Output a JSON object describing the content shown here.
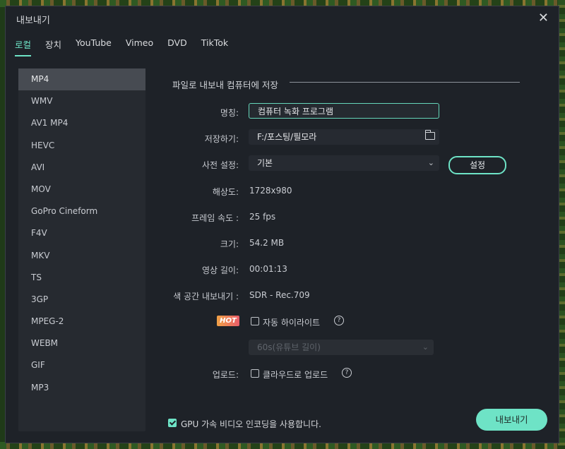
{
  "dialog": {
    "title": "내보내기",
    "close_glyph": "✕"
  },
  "tabs": [
    {
      "label": "로컬",
      "active": true
    },
    {
      "label": "장치"
    },
    {
      "label": "YouTube"
    },
    {
      "label": "Vimeo"
    },
    {
      "label": "DVD"
    },
    {
      "label": "TikTok"
    }
  ],
  "formats": [
    "MP4",
    "WMV",
    "AV1 MP4",
    "HEVC",
    "AVI",
    "MOV",
    "GoPro Cineform",
    "F4V",
    "MKV",
    "TS",
    "3GP",
    "MPEG-2",
    "WEBM",
    "GIF",
    "MP3"
  ],
  "selected_format": "MP4",
  "section": {
    "title": "파일로 내보내 컴퓨터에 저장"
  },
  "form": {
    "name_label": "명칭:",
    "name_value": "컴퓨터 녹화 프로그램",
    "save_label": "저장하기:",
    "save_path": "F:/포스팅/필모라",
    "preset_label": "사전 설정:",
    "preset_value": "기본",
    "settings_button": "설정",
    "resolution_label": "해상도:",
    "resolution_value": "1728x980",
    "framerate_label": "프레임 속도 :",
    "framerate_value": "25 fps",
    "size_label": "크기:",
    "size_value": "54.2 MB",
    "duration_label": "영상 길이:",
    "duration_value": "00:01:13",
    "colorspace_label": "색 공간 내보내기 :",
    "colorspace_value": "SDR - Rec.709",
    "hot_badge": "HOT",
    "auto_highlight_label": "자동 하이라이트",
    "auto_highlight_checked": false,
    "highlight_duration": "60s(유튜브 길이)",
    "upload_label": "업로드:",
    "cloud_upload_label": "클라우드로 업로드",
    "cloud_upload_checked": false,
    "help_glyph": "?"
  },
  "footer": {
    "gpu_label": "GPU 가속 비디오 인코딩을 사용합니다.",
    "gpu_checked": true,
    "export_button": "내보내기"
  },
  "colors": {
    "accent": "#6ee3c6",
    "dialog_bg": "#1e2228",
    "panel_bg": "#262a30"
  }
}
